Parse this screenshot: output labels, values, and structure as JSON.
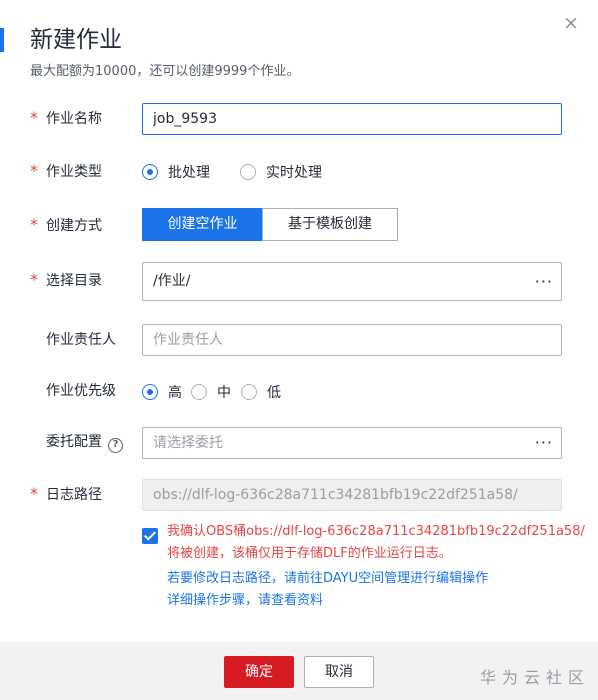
{
  "dialog": {
    "title": "新建作业",
    "subtitle": "最大配额为10000，还可以创建9999个作业。",
    "close_glyph": "×"
  },
  "form": {
    "required_mark": "*",
    "job_name": {
      "label": "作业名称",
      "value": "job_9593"
    },
    "job_type": {
      "label": "作业类型",
      "options": [
        "批处理",
        "实时处理"
      ],
      "selected": "批处理"
    },
    "create_mode": {
      "label": "创建方式",
      "options": [
        "创建空作业",
        "基于模板创建"
      ],
      "selected": "创建空作业"
    },
    "directory": {
      "label": "选择目录",
      "value": "/作业/",
      "picker_glyph": "···"
    },
    "owner": {
      "label": "作业责任人",
      "placeholder": "作业责任人"
    },
    "priority": {
      "label": "作业优先级",
      "options": [
        "高",
        "中",
        "低"
      ],
      "selected": "高"
    },
    "agency": {
      "label": "委托配置",
      "help_glyph": "?",
      "placeholder": "请选择委托",
      "picker_glyph": "···"
    },
    "log_path": {
      "label": "日志路径",
      "value": "obs://dlf-log-636c28a711c34281bfb19c22df251a58/"
    },
    "confirm_notice": {
      "checked": true,
      "line1": "我确认OBS桶obs://dlf-log-636c28a711c34281bfb19c22df251a58/",
      "line2": "将被创建，该桶仅用于存储DLF的作业运行日志。",
      "link1": "若要修改日志路径，请前往DAYU空间管理进行编辑操作",
      "link2": "详细操作步骤，请查看资料"
    }
  },
  "footer": {
    "ok_label": "确定",
    "cancel_label": "取消",
    "watermark": "华为云社区"
  },
  "colors": {
    "accent": "#1a73e8",
    "primary_button": "#d71b25",
    "required": "#e54545",
    "link": "#1a73e8"
  }
}
